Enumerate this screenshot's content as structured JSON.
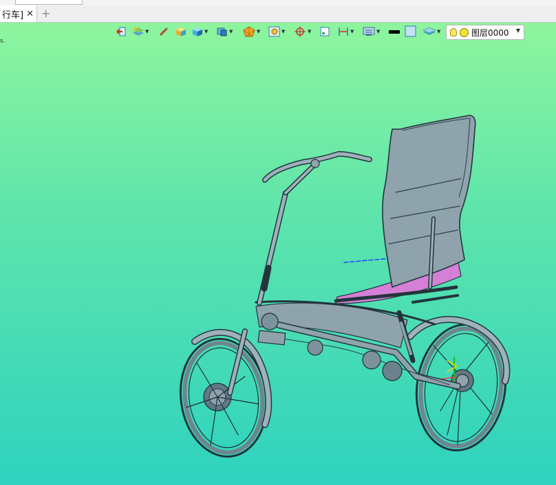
{
  "document_tab": {
    "label": "行车]",
    "close_icon": "✕"
  },
  "new_tab_icon": "+",
  "viewport": {
    "stray_text": "s."
  },
  "toolbar": {
    "icons": [
      "exit-sketch-icon",
      "layers-icon",
      "brush-icon",
      "shaded-box-icon",
      "solid-box-icon",
      "view-cube-icon",
      "render-ball-icon",
      "zoom-view-icon",
      "snap-target-icon",
      "small-window-icon",
      "dimension-icon",
      "display-icon",
      "line-color-icon",
      "fill-color-icon",
      "layer-stack-icon"
    ],
    "layer": {
      "name": "图层0000"
    }
  },
  "colors": {
    "line": "#000000",
    "fill": "#bfe3f0",
    "model": "#8fa3ad",
    "seat_highlight": "#d580d6"
  }
}
